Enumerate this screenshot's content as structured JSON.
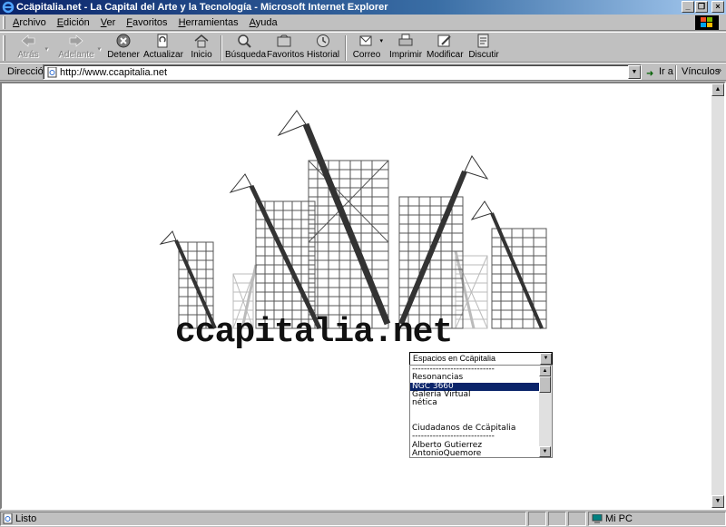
{
  "window": {
    "title": "Ccäpitalia.net - La Capital del Arte y la Tecnología - Microsoft Internet Explorer",
    "minimize": "_",
    "restore": "❐",
    "close": "×"
  },
  "menubar": {
    "items": [
      "Archivo",
      "Edición",
      "Ver",
      "Favoritos",
      "Herramientas",
      "Ayuda"
    ]
  },
  "toolbar": {
    "buttons": [
      {
        "label": "Atrás",
        "icon": "back-arrow-icon",
        "disabled": true
      },
      {
        "label": "Adelante",
        "icon": "forward-arrow-icon",
        "disabled": true
      },
      {
        "label": "Detener",
        "icon": "stop-icon"
      },
      {
        "label": "Actualizar",
        "icon": "refresh-icon"
      },
      {
        "label": "Inicio",
        "icon": "home-icon"
      },
      {
        "label": "Búsqueda",
        "icon": "search-icon"
      },
      {
        "label": "Favoritos",
        "icon": "favorites-icon"
      },
      {
        "label": "Historial",
        "icon": "history-icon"
      },
      {
        "label": "Correo",
        "icon": "mail-icon"
      },
      {
        "label": "Imprimir",
        "icon": "print-icon"
      },
      {
        "label": "Modificar",
        "icon": "edit-icon"
      },
      {
        "label": "Discutir",
        "icon": "discuss-icon"
      }
    ]
  },
  "address": {
    "label": "Dirección",
    "url": "http://www.ccapitalia.net",
    "go_label": "Ir a",
    "links_label": "Vínculos"
  },
  "page": {
    "logo_text": "ccapitalia.net",
    "select_value": "Espacios en Ccäpitalia",
    "list_items": [
      "----------------------------",
      "Resonancias",
      "NGC 3660",
      "Galería Virtual",
      "nética",
      "",
      "",
      "Ciudadanos de Ccäpitalia",
      "----------------------------",
      "Alberto Gutierrez",
      "AntonioQuemore"
    ],
    "selected_index": 2
  },
  "status": {
    "text": "Listo",
    "zone": "Mi PC"
  },
  "colors": {
    "titlebar": "#0a246a",
    "selection": "#0a246a",
    "chrome": "#c0c0c0"
  }
}
